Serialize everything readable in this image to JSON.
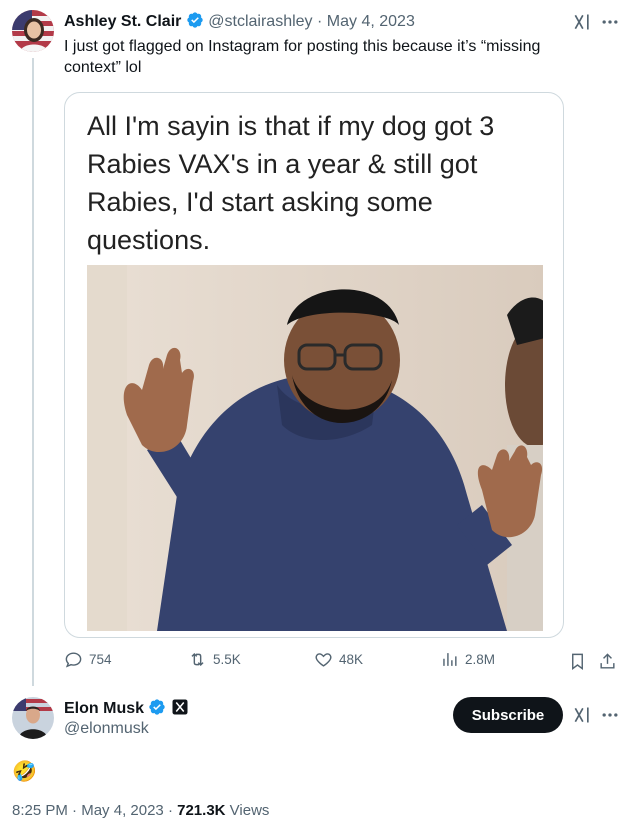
{
  "original_tweet": {
    "display_name": "Ashley St. Clair",
    "handle": "@stclairashley",
    "date": "· May 4, 2023",
    "text": "I just got flagged on Instagram for posting this because it’s “missing context” lol",
    "media": {
      "caption": "All I'm sayin is that if my dog got 3 Rabies VAX's in a year & still got Rabies, I'd start asking some questions."
    },
    "stats": {
      "replies": "754",
      "reposts": "5.5K",
      "likes": "48K",
      "views": "2.8M"
    }
  },
  "reply": {
    "display_name": "Elon Musk",
    "handle": "@elonmusk",
    "subscribe_label": "Subscribe",
    "text": "🤣",
    "time": "8:25 PM",
    "date": "May 4, 2023",
    "views_count": "721.3K",
    "views_label": "Views"
  },
  "icons": {
    "verified": "verified-badge-icon",
    "affiliate": "x-affiliate-badge-icon",
    "grok": "grok-icon",
    "more": "more-icon",
    "reply": "reply-icon",
    "repost": "repost-icon",
    "like": "like-icon",
    "views": "views-icon",
    "bookmark": "bookmark-icon",
    "share": "share-icon"
  },
  "colors": {
    "verified_blue": "#1d9bf0",
    "text_primary": "#0f1419",
    "text_muted": "#536471",
    "border": "#cfd9de"
  }
}
